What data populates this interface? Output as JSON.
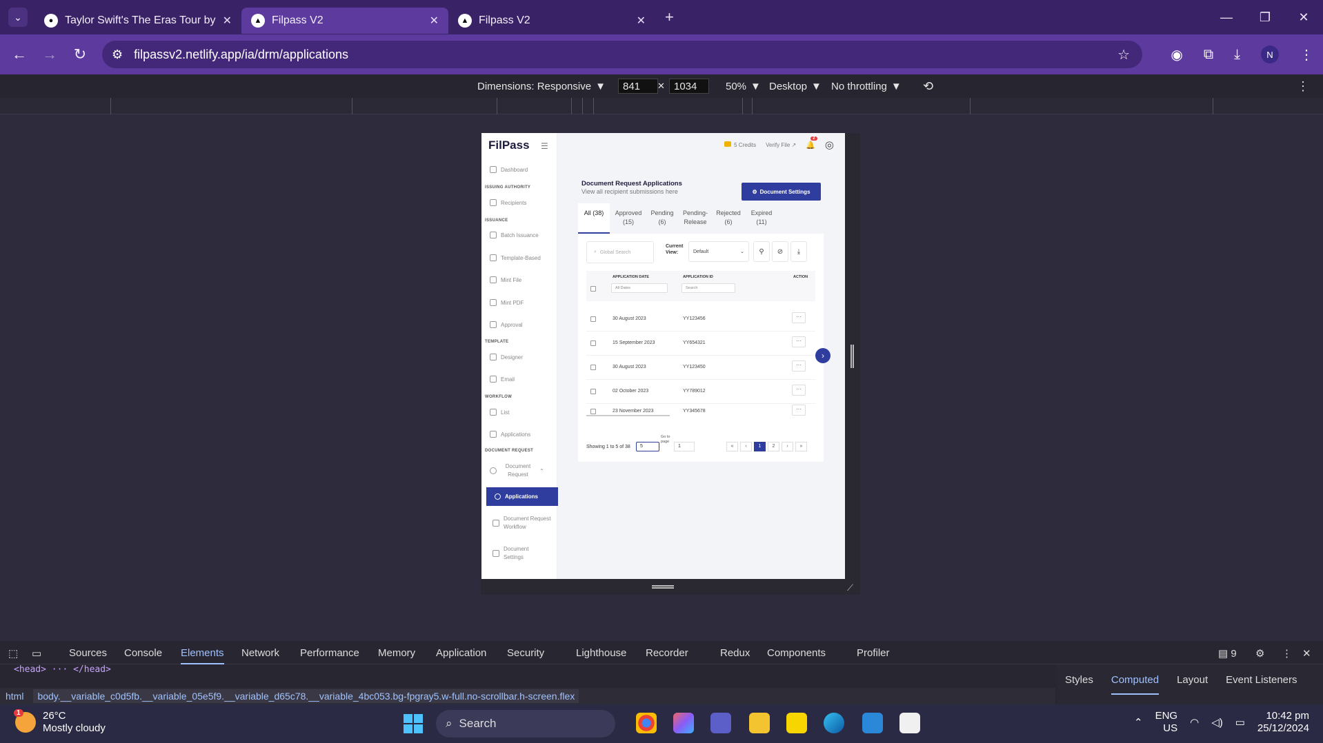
{
  "browser": {
    "tabs": [
      {
        "title": "Taylor Swift's The Eras Tour by N",
        "active": false
      },
      {
        "title": "Filpass V2",
        "active": true
      },
      {
        "title": "Filpass V2",
        "active": false
      }
    ],
    "url": "filpassv2.netlify.app/ia/drm/applications",
    "profile_initial": "N"
  },
  "device_toolbar": {
    "dimensions": "Dimensions: Responsive",
    "width": "841",
    "height": "1034",
    "zoom": "50%",
    "device": "Desktop",
    "throttling": "No throttling"
  },
  "app": {
    "logo": "FilPass",
    "sidebar": {
      "dashboard": "Dashboard",
      "sec_issuing": "ISSUING AUTHORITY",
      "recipients": "Recipients",
      "sec_issuance": "ISSUANCE",
      "batch": "Batch Issuance",
      "template_based": "Template-Based",
      "mint_file": "Mint File",
      "mint_pdf": "Mint PDF",
      "approval": "Approval",
      "sec_template": "TEMPLATE",
      "designer": "Designer",
      "email": "Email",
      "sec_workflow": "WORKFLOW",
      "list": "List",
      "applications_wf": "Applications",
      "sec_docreq": "DOCUMENT REQUEST",
      "document_request": "Document Request",
      "applications": "Applications",
      "docreq_workflow": "Document Request Workflow",
      "doc_settings": "Document Settings"
    },
    "topbar": {
      "credits": "5 Credits",
      "verify": "Verify File",
      "notifications": "2"
    },
    "header": {
      "title": "Document Request Applications",
      "subtitle": "View all recipient submissions here",
      "settings_button": "Document Settings"
    },
    "tabs": [
      {
        "label": "All (38)"
      },
      {
        "label": "Approved (15)"
      },
      {
        "label": "Pending (6)"
      },
      {
        "label": "Pending-Release"
      },
      {
        "label": "Rejected (6)"
      },
      {
        "label": "Expired (11)"
      }
    ],
    "filters": {
      "search_placeholder": "Global Search",
      "current_view_label": "Current View:",
      "current_view": "Default"
    },
    "table": {
      "col_date": "APPLICATION DATE",
      "col_id": "APPLICATION ID",
      "col_action": "ACTION",
      "date_filter": "All Dates",
      "id_filter": "Search",
      "rows": [
        {
          "date": "30 August 2023",
          "id": "YY123456"
        },
        {
          "date": "15 September 2023",
          "id": "YY654321"
        },
        {
          "date": "30 August 2023",
          "id": "YY123450"
        },
        {
          "date": "02 October 2023",
          "id": "YY789012"
        },
        {
          "date": "23 November 2023",
          "id": "YY345678"
        }
      ],
      "action_label": "···"
    },
    "pagination": {
      "showing": "Showing 1 to 5 of 38",
      "page_size": "5",
      "goto_label": "Go to page",
      "goto_value": "1",
      "first": "«",
      "prev": "‹",
      "page1": "1",
      "page2": "2",
      "next": "›",
      "last": "»"
    }
  },
  "devtools": {
    "tabs": [
      "Sources",
      "Console",
      "Elements",
      "Network",
      "Performance",
      "Memory",
      "Application",
      "Security",
      "Lighthouse",
      "Recorder",
      "Redux",
      "Components",
      "Profiler"
    ],
    "selected_tab": "Elements",
    "issues": "9",
    "head_line": "<head> ··· </head>",
    "breadcrumb_html": "html",
    "breadcrumb_body": "body.__variable_c0d5fb.__variable_05e5f9.__variable_d65c78.__variable_4bc053.bg-fpgray5.w-full.no-scrollbar.h-screen.flex",
    "side_tabs": [
      "Styles",
      "Computed",
      "Layout",
      "Event Listeners"
    ]
  },
  "taskbar": {
    "temp": "26°C",
    "weather": "Mostly cloudy",
    "weather_badge": "1",
    "search": "Search",
    "lang1": "ENG",
    "lang2": "US",
    "time": "10:42 pm",
    "date": "25/12/2024"
  }
}
